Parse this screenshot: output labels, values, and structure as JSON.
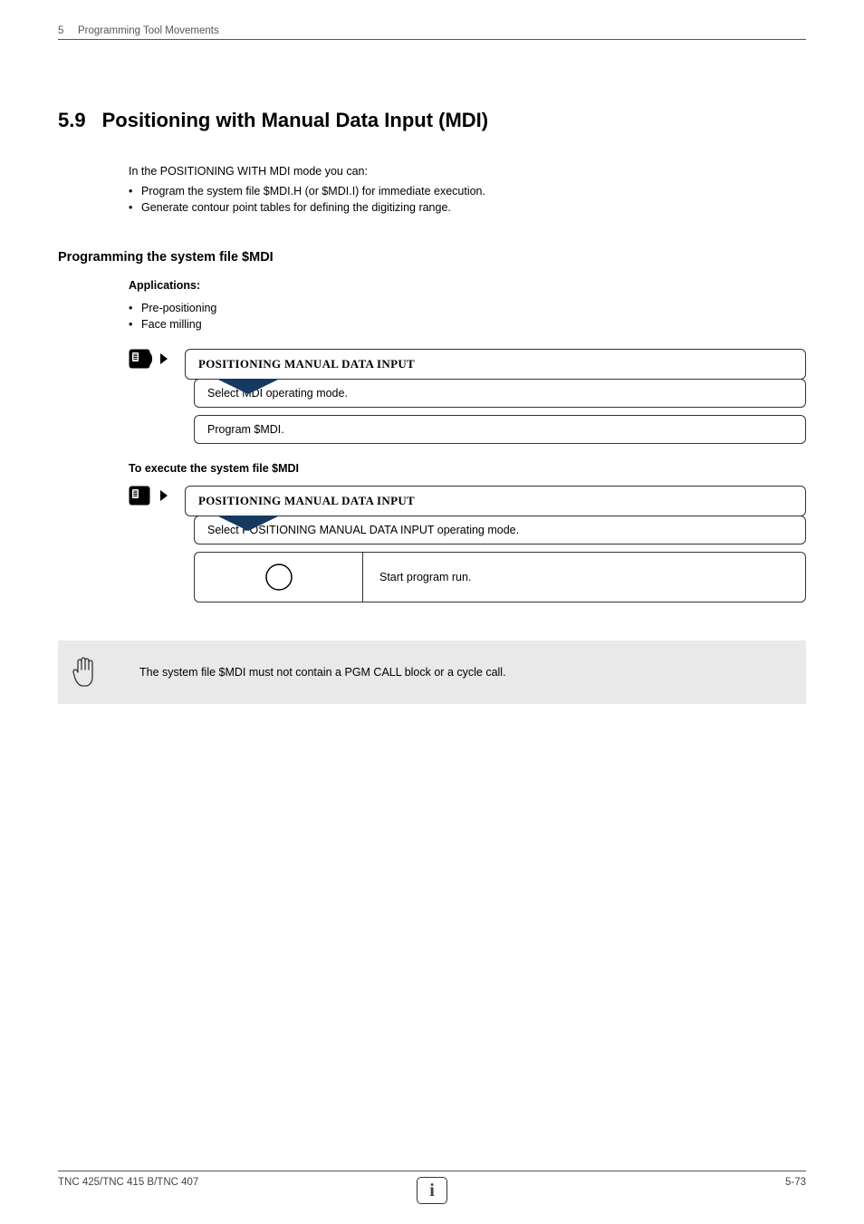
{
  "header": {
    "chapter_number": "5",
    "chapter_title": "Programming Tool Movements"
  },
  "section": {
    "number": "5.9",
    "title": "Positioning with Manual Data Input (MDI)"
  },
  "intro": {
    "lead": "In the POSITIONING WITH MDI mode you can:",
    "bullets": [
      "Program the system file $MDI.H (or $MDI.I) for immediate execution.",
      "Generate contour point tables for defining the digitizing range."
    ]
  },
  "subsection_title": "Programming the system file $MDI",
  "applications": {
    "heading": "Applications:",
    "items": [
      "Pre-positioning",
      "Face milling"
    ]
  },
  "step1": {
    "title": "POSITIONING MANUAL DATA INPUT",
    "sub1": "Select MDI operating mode.",
    "sub2": "Program $MDI."
  },
  "exec_heading": "To execute the system file $MDI",
  "step2": {
    "title": "POSITIONING MANUAL DATA INPUT",
    "sub1": "Select POSITIONING MANUAL DATA INPUT operating mode.",
    "button_text": "Start program run."
  },
  "note": "The system file $MDI must not contain a PGM CALL block or a cycle call.",
  "footer": {
    "left": "TNC 425/TNC 415 B/TNC 407",
    "right": "5-73",
    "info_glyph": "i"
  }
}
